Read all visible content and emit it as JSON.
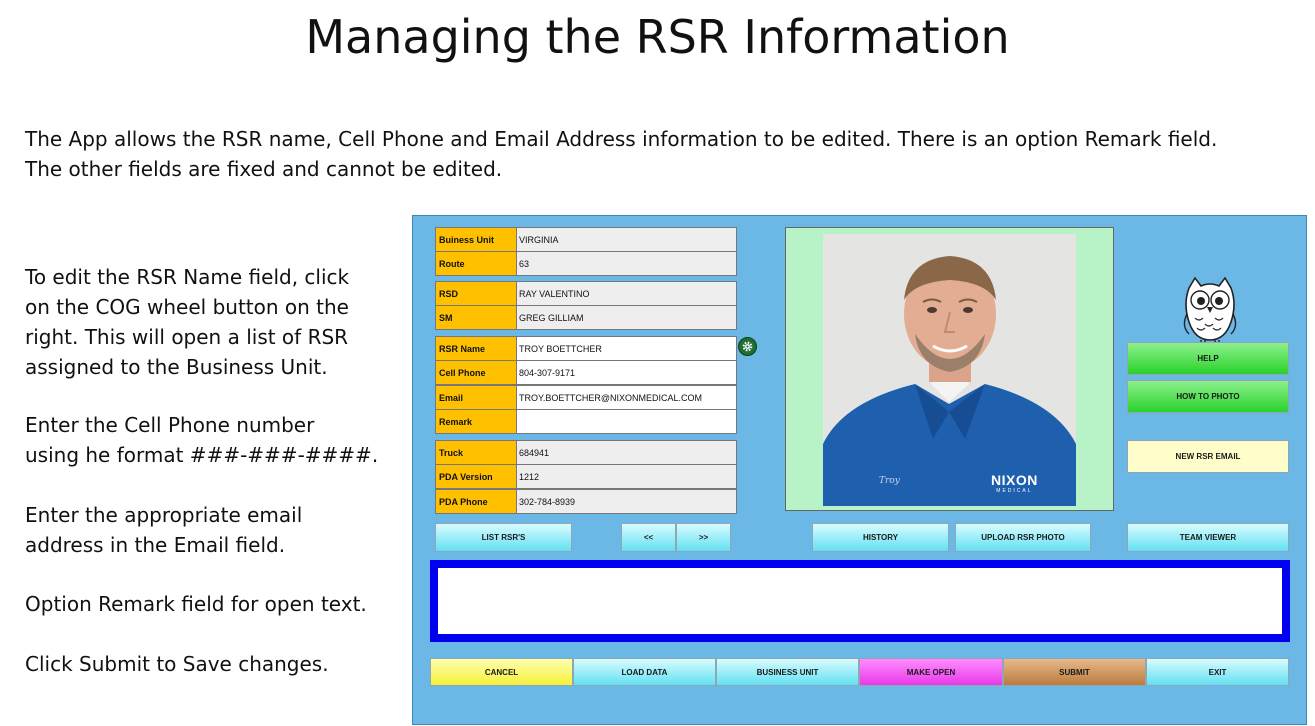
{
  "slide": {
    "title": "Managing the RSR Information",
    "intro_line1": "The App allows the RSR name, Cell Phone and Email Address information to be edited.  There is an option Remark field.",
    "intro_line2": "The other fields are fixed and cannot be edited.",
    "instructions": [
      {
        "line1": "To edit the RSR Name field, click",
        "line2": "on the COG wheel button on the",
        "line3": "right.  This will open a list of RSR",
        "line4": "assigned to the Business Unit."
      },
      {
        "line1": "Enter the Cell Phone number",
        "line2": "using he format ###-###-####."
      },
      {
        "line1": "Enter the appropriate email",
        "line2": "address in the Email field."
      },
      {
        "line1": "Option Remark field for open text."
      },
      {
        "line1": "Click Submit to Save changes."
      }
    ]
  },
  "form": {
    "fields": [
      {
        "label": "Buiness Unit",
        "value": "VIRGINIA"
      },
      {
        "label": "Route",
        "value": "63"
      },
      {
        "label": "RSD",
        "value": "RAY VALENTINO"
      },
      {
        "label": "SM",
        "value": "GREG GILLIAM"
      },
      {
        "label": "RSR Name",
        "value": "TROY BOETTCHER"
      },
      {
        "label": "Cell Phone",
        "value": "804-307-9171"
      },
      {
        "label": "Email",
        "value": "TROY.BOETTCHER@NIXONMEDICAL.COM"
      },
      {
        "label": "Remark",
        "value": ""
      },
      {
        "label": "Truck",
        "value": "684941"
      },
      {
        "label": "PDA Version",
        "value": "1212"
      },
      {
        "label": "PDA Phone",
        "value": "302-784-8939"
      }
    ],
    "cog_icon": "cog-wheel-icon"
  },
  "photo": {
    "shirt_name": "Troy",
    "logo_text": "NIXON",
    "logo_subtext": "MEDICAL"
  },
  "buttons": {
    "help": "HELP",
    "how_to_photo": "HOW TO PHOTO",
    "new_rsr_email": "NEW RSR EMAIL",
    "list_rsrs": "LIST RSR'S",
    "prev": "<<",
    "next": ">>",
    "history": "HISTORY",
    "upload_rsr_photo": "UPLOAD RSR PHOTO",
    "team_viewer": "TEAM VIEWER",
    "cancel": "CANCEL",
    "load_data": "LOAD DATA",
    "business_unit": "BUSINESS UNIT",
    "make_open": "MAKE OPEN",
    "submit": "SUBMIT",
    "exit": "EXIT"
  },
  "colors": {
    "app_background": "#6bb8e6",
    "label_background": "#ffc000",
    "remark_border": "#0000f0",
    "photo_panel": "#b8f2c7"
  }
}
